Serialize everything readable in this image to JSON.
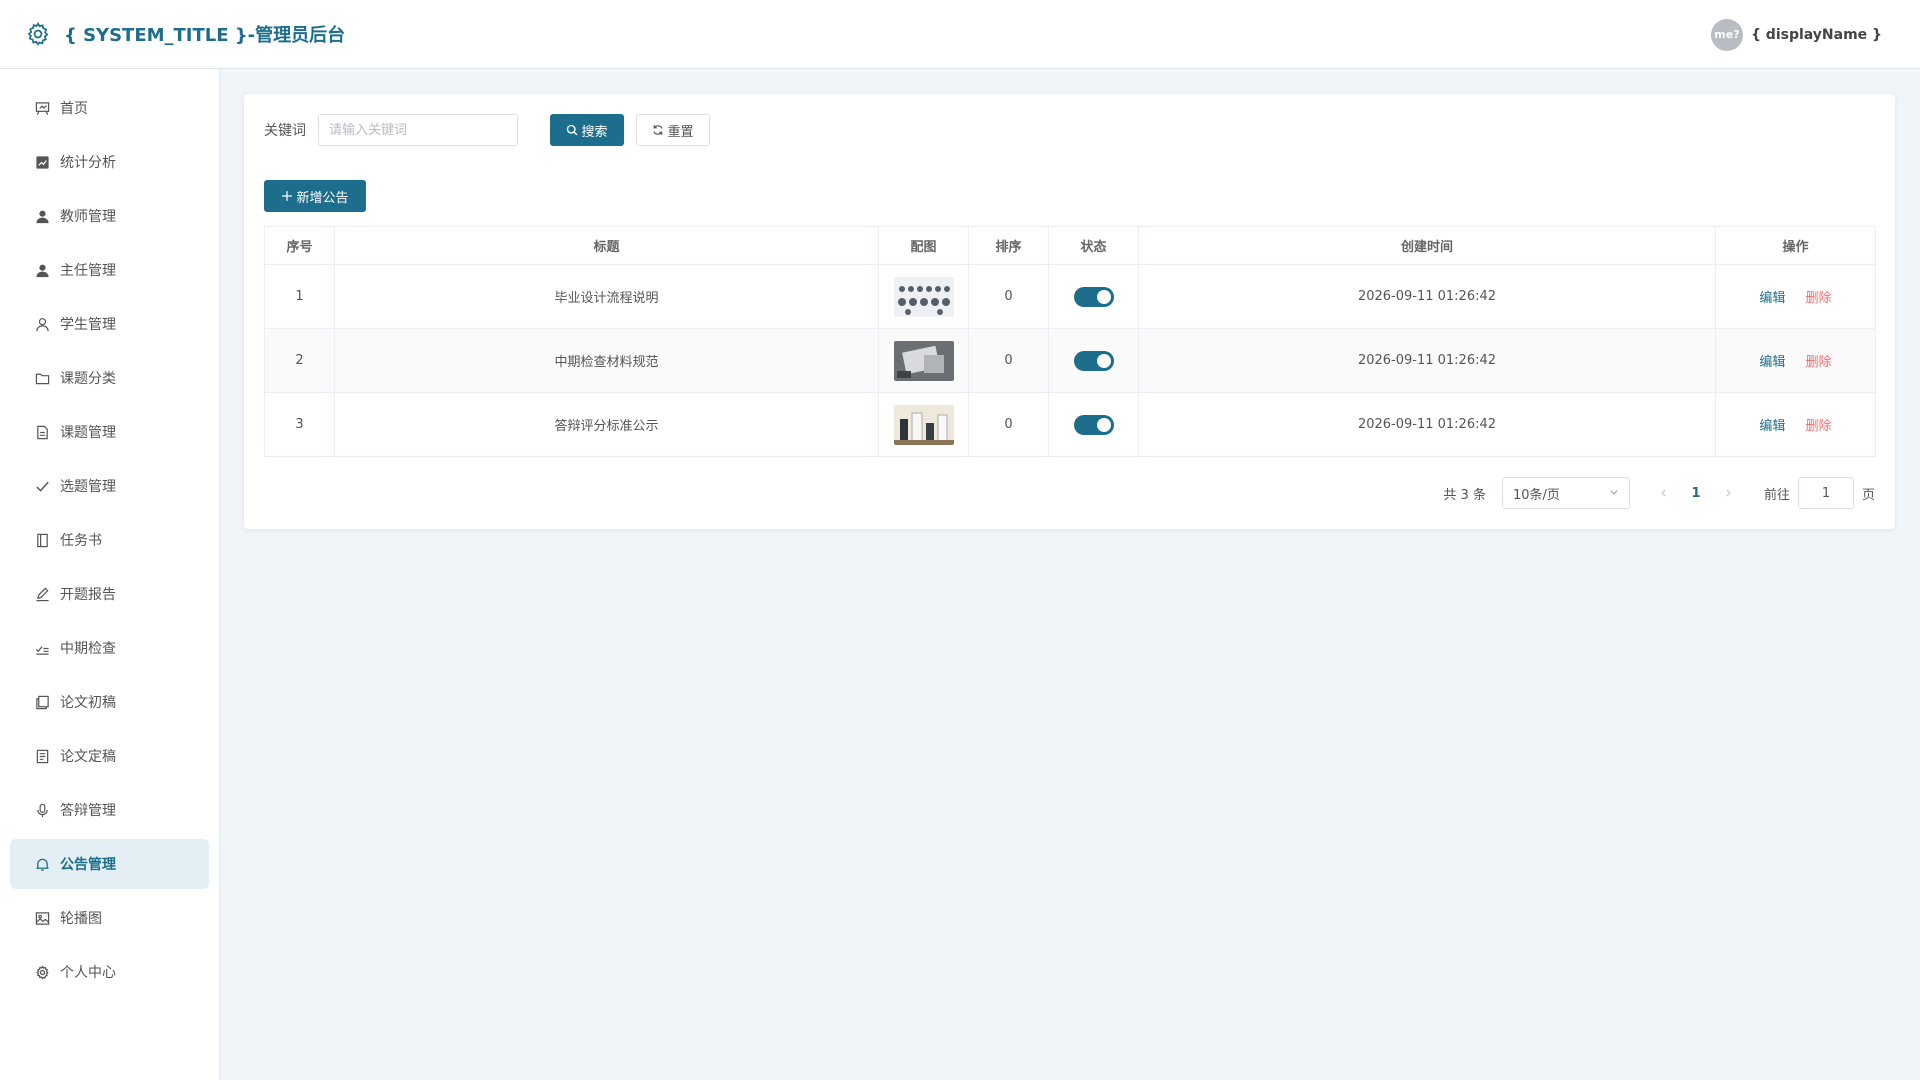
{
  "header": {
    "system_title": "{ SYSTEM_TITLE }-管理员后台",
    "avatar_text": "me?",
    "display_name": "{ displayName }"
  },
  "colors": {
    "primary": "#1c6e8c",
    "danger": "#f56c6c",
    "active_bg": "#e4eff5"
  },
  "sidebar": {
    "items": [
      {
        "label": "首页",
        "icon": "home-board-icon"
      },
      {
        "label": "统计分析",
        "icon": "chart-icon"
      },
      {
        "label": "教师管理",
        "icon": "user-filled-icon"
      },
      {
        "label": "主任管理",
        "icon": "user-filled-icon"
      },
      {
        "label": "学生管理",
        "icon": "user-outline-icon"
      },
      {
        "label": "课题分类",
        "icon": "folder-icon"
      },
      {
        "label": "课题管理",
        "icon": "document-icon"
      },
      {
        "label": "选题管理",
        "icon": "check-icon"
      },
      {
        "label": "任务书",
        "icon": "notebook-icon"
      },
      {
        "label": "开题报告",
        "icon": "edit-pen-icon"
      },
      {
        "label": "中期检查",
        "icon": "check-list-icon"
      },
      {
        "label": "论文初稿",
        "icon": "copy-document-icon"
      },
      {
        "label": "论文定稿",
        "icon": "tickets-icon"
      },
      {
        "label": "答辩管理",
        "icon": "microphone-icon"
      },
      {
        "label": "公告管理",
        "icon": "bell-icon",
        "active": true
      },
      {
        "label": "轮播图",
        "icon": "picture-icon"
      },
      {
        "label": "个人中心",
        "icon": "setting-icon"
      }
    ]
  },
  "search": {
    "keyword_label": "关键词",
    "placeholder": "请输入关键词",
    "search_label": "搜索",
    "reset_label": "重置"
  },
  "toolbar": {
    "add_label": "新增公告"
  },
  "table": {
    "columns": [
      "序号",
      "标题",
      "配图",
      "排序",
      "状态",
      "创建时间",
      "操作"
    ],
    "rows": [
      {
        "index": "1",
        "title": "毕业设计流程说明",
        "sort": "0",
        "status_on": true,
        "created": "2026-09-11 01:26:42"
      },
      {
        "index": "2",
        "title": "中期检查材料规范",
        "sort": "0",
        "status_on": true,
        "created": "2026-09-11 01:26:42"
      },
      {
        "index": "3",
        "title": "答辩评分标准公示",
        "sort": "0",
        "status_on": true,
        "created": "2026-09-11 01:26:42"
      }
    ],
    "edit_label": "编辑",
    "delete_label": "删除"
  },
  "pagination": {
    "total_text": "共 3 条",
    "page_size": "10条/页",
    "current_page": "1",
    "goto_label": "前往",
    "goto_value": "1",
    "page_suffix": "页"
  }
}
